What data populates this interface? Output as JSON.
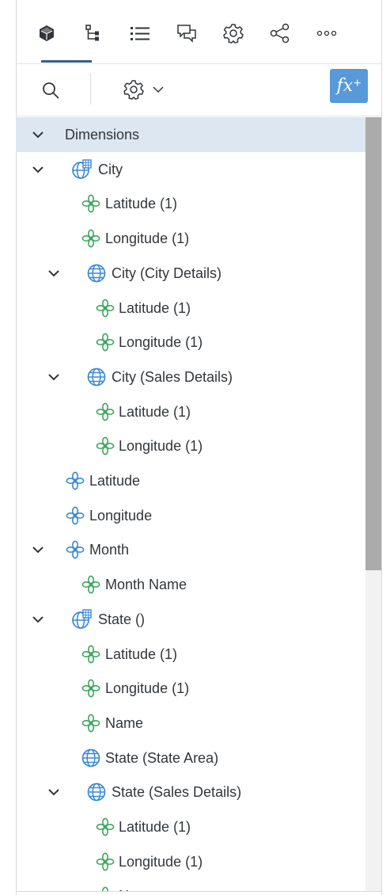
{
  "tabs": [
    {
      "id": "model",
      "icon": "cube-icon"
    },
    {
      "id": "hierarchy",
      "icon": "hierarchy-icon"
    },
    {
      "id": "list",
      "icon": "list-icon"
    },
    {
      "id": "comments",
      "icon": "comments-icon"
    },
    {
      "id": "settings",
      "icon": "gear-icon"
    },
    {
      "id": "share",
      "icon": "share-icon"
    },
    {
      "id": "more",
      "icon": "more-icon"
    }
  ],
  "toolbar": {
    "search_icon": "search-icon",
    "settings_icon": "gear-icon",
    "dropdown_icon": "chevron-down-icon",
    "fx_label": "fx",
    "fx_plus": "+"
  },
  "tree": {
    "header": "Dimensions",
    "rows": [
      {
        "label": "City",
        "icon": "globe-grid-icon"
      },
      {
        "label": "Latitude (1)",
        "icon": "flower-icon"
      },
      {
        "label": "Longitude (1)",
        "icon": "flower-icon"
      },
      {
        "label": "City (City Details)",
        "icon": "globe-icon"
      },
      {
        "label": "Latitude (1)",
        "icon": "flower-icon"
      },
      {
        "label": "Longitude (1)",
        "icon": "flower-icon"
      },
      {
        "label": "City (Sales Details)",
        "icon": "globe-icon"
      },
      {
        "label": "Latitude (1)",
        "icon": "flower-icon"
      },
      {
        "label": "Longitude (1)",
        "icon": "flower-icon"
      },
      {
        "label": "Latitude",
        "icon": "blue-flower-icon"
      },
      {
        "label": "Longitude",
        "icon": "blue-flower-icon"
      },
      {
        "label": "Month",
        "icon": "blue-flower-icon"
      },
      {
        "label": "Month Name",
        "icon": "flower-icon"
      },
      {
        "label": "State ()",
        "icon": "globe-grid-icon"
      },
      {
        "label": "Latitude (1)",
        "icon": "flower-icon"
      },
      {
        "label": "Longitude (1)",
        "icon": "flower-icon"
      },
      {
        "label": "Name",
        "icon": "flower-icon"
      },
      {
        "label": "State (State Area)",
        "icon": "globe-icon"
      },
      {
        "label": "State (Sales Details)",
        "icon": "globe-icon"
      },
      {
        "label": "Latitude (1)",
        "icon": "flower-icon"
      },
      {
        "label": "Longitude (1)",
        "icon": "flower-icon"
      },
      {
        "label": "Name",
        "icon": "flower-icon"
      }
    ]
  },
  "colors": {
    "accent": "#346187",
    "header_bg": "#dde7f1",
    "fx_button": "#5899da",
    "green_icon": "#3fa75f",
    "blue_icon": "#3b8ad4"
  }
}
